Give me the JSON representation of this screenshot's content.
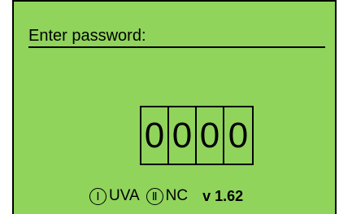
{
  "screen": {
    "background": "#90d45c",
    "title": "Enter password:"
  },
  "password": {
    "digits": [
      "0",
      "0",
      "0",
      "0"
    ]
  },
  "footer": {
    "mode1_symbol": "Ⅰ",
    "mode1_label": "UVA",
    "mode2_symbol": "Ⅱ",
    "mode2_label": "NC",
    "version": "v 1.62"
  }
}
